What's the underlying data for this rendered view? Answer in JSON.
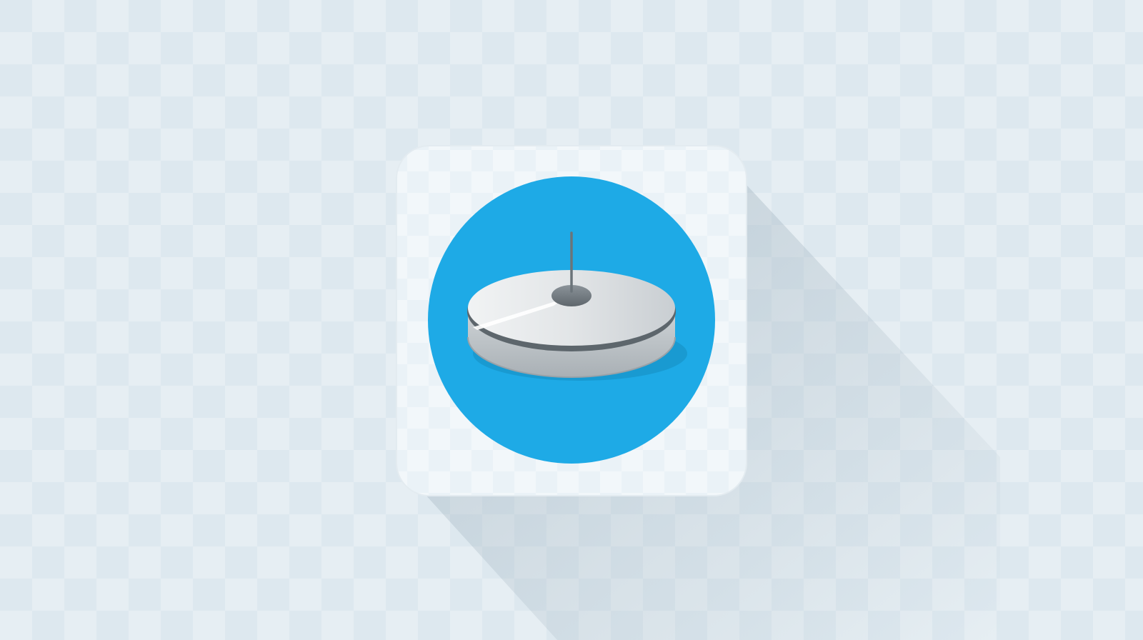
{
  "canvas": {
    "background_color": "#dde8ef",
    "pattern": "checkerboard"
  },
  "app_icon": {
    "icon_name": "router-icon",
    "tile_color": "#eef4f8",
    "circle_color": "#1eaae6",
    "device_color": "#d6dadd",
    "device_edge_color": "#5d666c",
    "antenna_color": "#6b747a",
    "long_shadow": true
  }
}
